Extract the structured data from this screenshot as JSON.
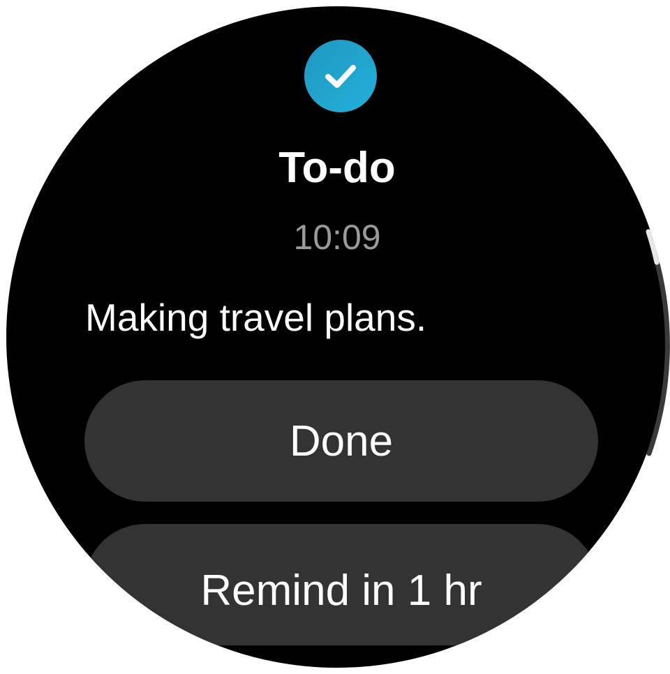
{
  "notification": {
    "app_icon": "checkmark-icon",
    "accent_color": "#1fa5d0",
    "title": "To-do",
    "time": "10:09",
    "message": "Making travel plans."
  },
  "actions": {
    "done_label": "Done",
    "remind_label": "Remind in 1 hr"
  },
  "scroll": {
    "position_fraction": 0.12
  }
}
